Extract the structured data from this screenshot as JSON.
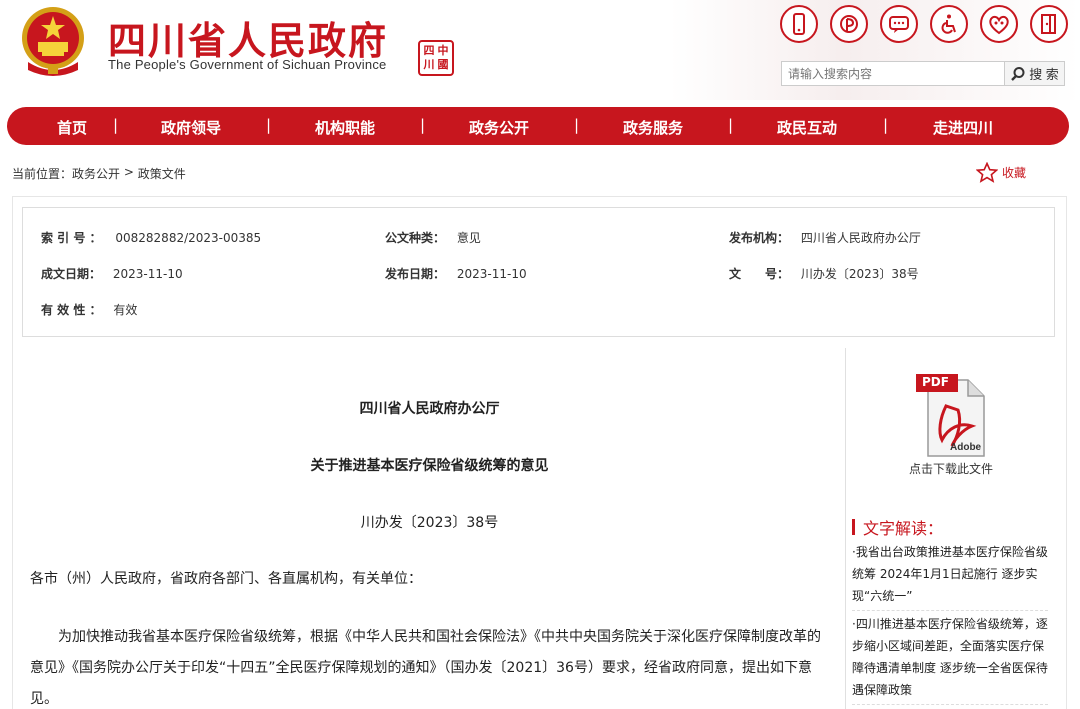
{
  "header": {
    "site_title_cn": "四川省人民政府",
    "site_title_en": "The People's Government of Sichuan Province",
    "seal_chars": [
      "四",
      "中",
      "川",
      "國"
    ],
    "search_placeholder": "请输入搜索内容",
    "search_button": "搜 索",
    "top_icons": [
      "mobile-icon",
      "weibo-icon",
      "wechat-icon",
      "accessibility-icon",
      "elderly-care-icon",
      "exit-icon"
    ]
  },
  "nav": {
    "items": [
      "首页",
      "政府领导",
      "机构职能",
      "政务公开",
      "政务服务",
      "政民互动",
      "走进四川"
    ]
  },
  "breadcrumb": {
    "prefix": "当前位置：",
    "level1": "政务公开",
    "sep": " > ",
    "level2": "政策文件"
  },
  "favorite_label": "收藏",
  "meta": {
    "index_label": "索 引 号 ：",
    "index_value": "008282882/2023-00385",
    "category_label": "公文种类：",
    "category_value": "意见",
    "publisher_label": "发布机构：",
    "publisher_value": "四川省人民政府办公厅",
    "written_label": "成文日期：",
    "written_value": "2023-11-10",
    "published_label": "发布日期：",
    "published_value": "2023-11-10",
    "docno_label": "文　　号：",
    "docno_value": "川办发〔2023〕38号",
    "validity_label": "有 效 性 ：",
    "validity_value": "有效"
  },
  "document": {
    "issuer": "四川省人民政府办公厅",
    "title": "关于推进基本医疗保险省级统筹的意见",
    "number": "川办发〔2023〕38号",
    "salutation": "各市（州）人民政府，省政府各部门、各直属机构，有关单位：",
    "paragraph1": "为加快推动我省基本医疗保险省级统筹，根据《中华人民共和国社会保险法》《中共中央国务院关于深化医疗保障制度改革的意见》《国务院办公厅关于印发“十四五”全民医疗保障规划的通知》（国办发〔2021〕36号）要求，经省政府同意，提出如下意见。"
  },
  "sidebar": {
    "pdf_top": "PDF",
    "pdf_bottom": "Adobe",
    "pdf_caption": "点击下载此文件",
    "interp_title": "文字解读：",
    "interp_items": [
      "·我省出台政策推进基本医疗保险省级统筹 2024年1月1日起施行 逐步实现“六统一”",
      "·四川推进基本医疗保险省级统筹，逐步缩小区域间差距，全面落实医疗保障待遇清单制度 逐步统一全省医保待遇保障政策"
    ]
  },
  "colors": {
    "brand_red": "#c7161e"
  }
}
